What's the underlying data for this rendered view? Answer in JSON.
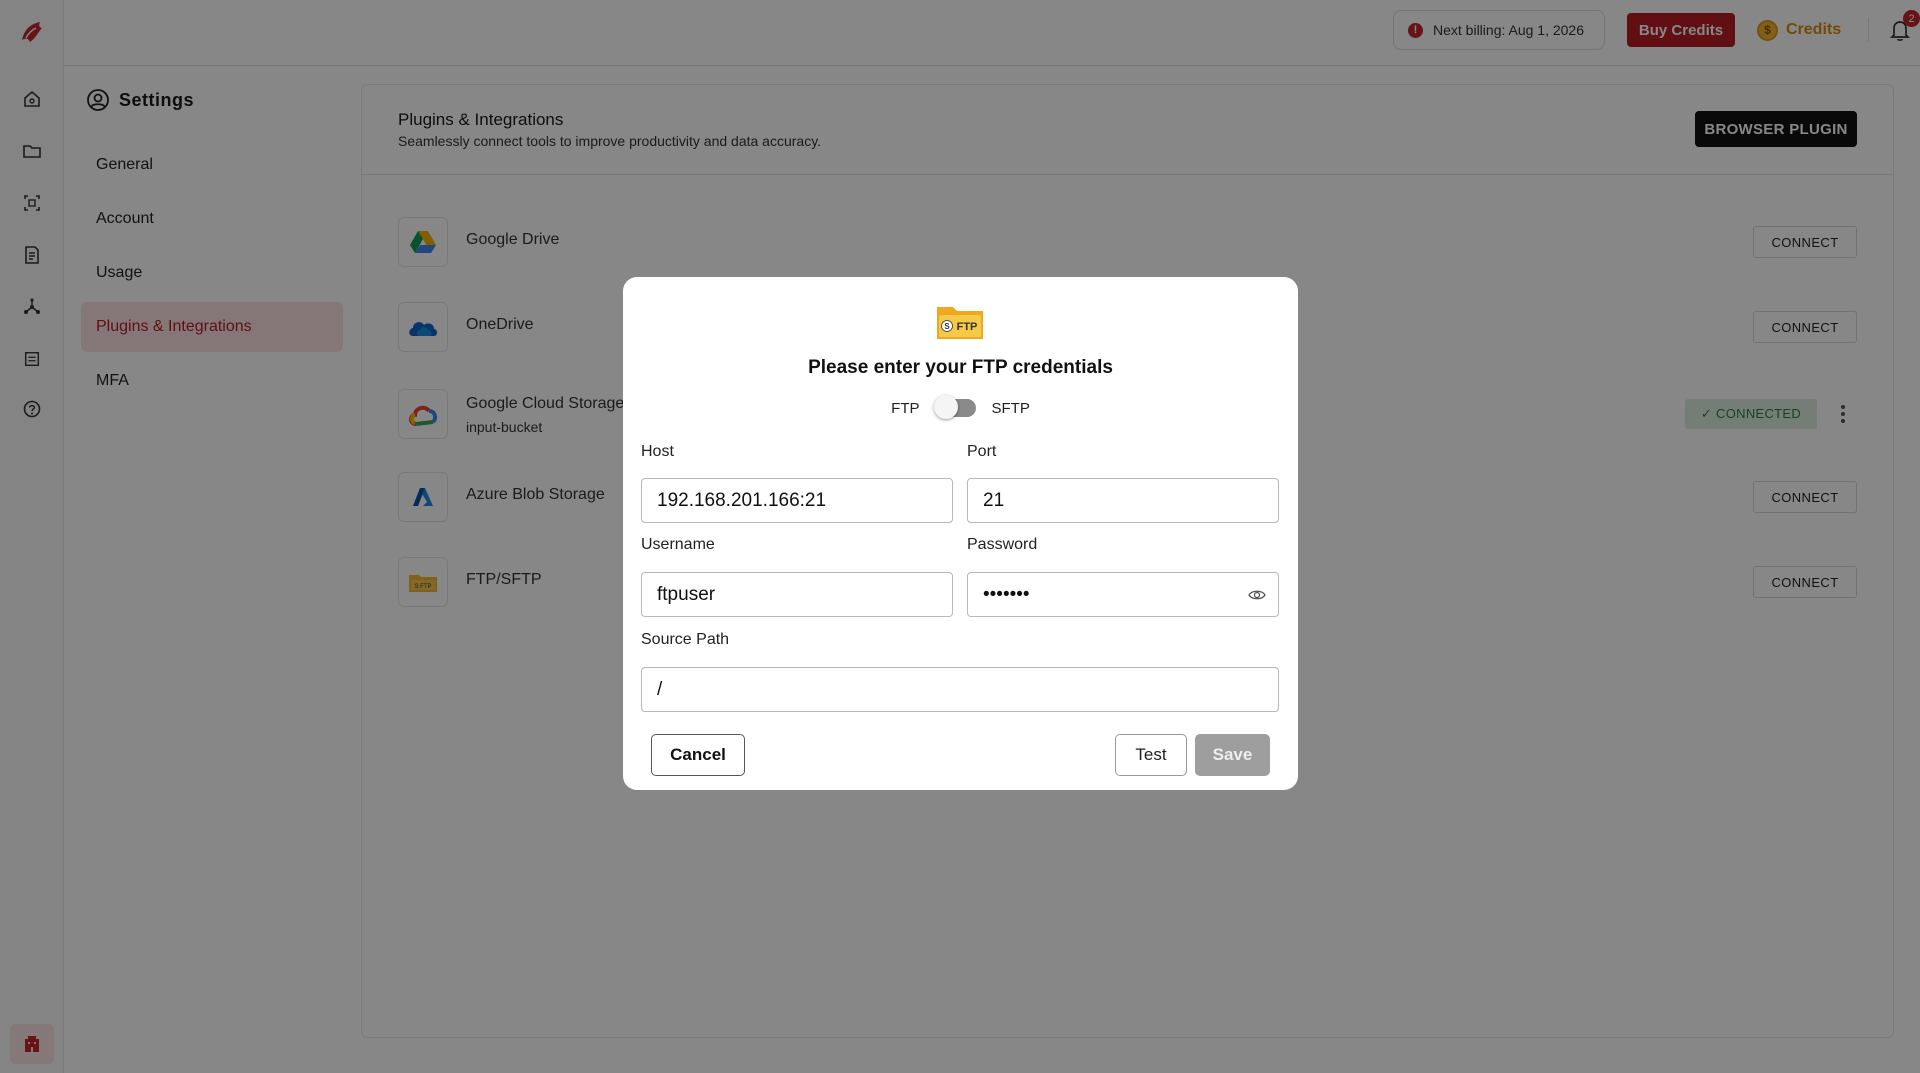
{
  "topbar": {
    "billing_text": "Next billing: Aug 1, 2026",
    "buy_credits_label": "Buy Credits",
    "credits_label": "Credits",
    "notification_count": "2"
  },
  "settings": {
    "title": "Settings",
    "nav": [
      "General",
      "Account",
      "Usage",
      "Plugins & Integrations",
      "MFA"
    ],
    "active_index": 3
  },
  "panel": {
    "title": "Plugins & Integrations",
    "subtitle": "Seamlessly connect tools to improve productivity and data accuracy.",
    "browser_plugin_label": "BROWSER PLUGIN",
    "integrations": [
      {
        "name": "Google Drive",
        "action": "CONNECT"
      },
      {
        "name": "OneDrive",
        "action": "CONNECT"
      },
      {
        "name": "Google Cloud Storage",
        "sub": "input-bucket",
        "status": "✓ CONNECTED"
      },
      {
        "name": "Azure Blob Storage",
        "action": "CONNECT"
      },
      {
        "name": "FTP/SFTP",
        "action": "CONNECT"
      }
    ]
  },
  "modal": {
    "title": "Please enter your FTP credentials",
    "toggle_left": "FTP",
    "toggle_right": "SFTP",
    "host_label": "Host",
    "host_value": "192.168.201.166:21",
    "port_label": "Port",
    "port_value": "21",
    "username_label": "Username",
    "username_value": "ftpuser",
    "password_label": "Password",
    "password_value": "•••••••",
    "source_path_label": "Source Path",
    "source_path_value": "/",
    "cancel_label": "Cancel",
    "test_label": "Test",
    "save_label": "Save"
  },
  "colors": {
    "brand": "#b81e25",
    "credits": "#d98b0c",
    "connected_bg": "#dcefe0",
    "connected_fg": "#2e7d3e"
  },
  "icons": {
    "rail": [
      "home-icon",
      "folder-icon",
      "scan-icon",
      "document-icon",
      "workflow-icon",
      "table-icon",
      "help-circle-icon"
    ],
    "bottom": "building-icon"
  }
}
